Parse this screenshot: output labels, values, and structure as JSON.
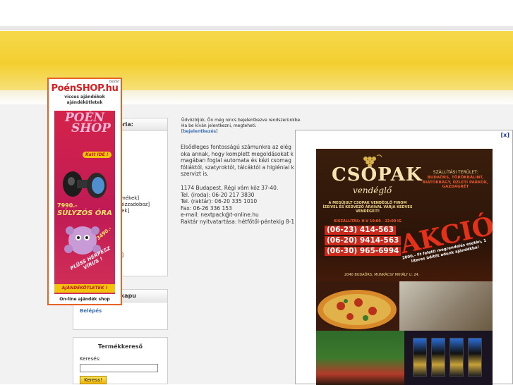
{
  "left": {
    "categories_title": "ória:",
    "categories": [
      "]",
      "",
      "r]",
      "",
      "",
      "k]",
      "k]",
      "",
      "",
      "ermékek]",
      "k pizzadoboz]",
      "ékek]",
      "",
      "",
      "",
      "",
      "",
      "",
      "ek]"
    ],
    "login_title": "kapu",
    "login_link": "Belépés",
    "search_title": "Termékkereső",
    "search_label": "Keresés:",
    "search_button": "Keress!"
  },
  "poenshop_ad": {
    "close": "bezár",
    "logo": "PoénSHOP.hu",
    "tagline_1": "vicces ajándékok",
    "tagline_2": "ajándékötletek",
    "brand_1": "POÉN",
    "brand_2": "SHOP",
    "katt": "Katt IDE !",
    "price_1": "7990.-",
    "product_1": "SÚLYZÓS ÓRA",
    "price_2": "3490.-",
    "product_2_line1": "PLÜSS HERPESZ",
    "product_2_line2": "VÍRUS !",
    "banner": "AJÁNDÉKÖTLETEK !",
    "footer": "On-line ajándék shop"
  },
  "main": {
    "welcome_1": "Üdvözöljük, Ön még nincs bejelentkezve rendszerünkbe.",
    "welcome_2": "Ha be kíván jelentkezni, megteheti.",
    "welcome_link": "bejelentkezés",
    "intro": [
      "Elsődleges fontosságú számunkra az elég",
      "oka annak, hogy komplett megoldásokat k",
      "magában foglal automata és kézi csomag",
      "fóliáktól, szatyroktól, tálcáktól a higiéniai k",
      "szervizt is."
    ],
    "contact": [
      "1174 Budapest, Régi vám köz 37-40.",
      "Tel. (iroda): 06-20 217 3830",
      "Tel. (raktár): 06-20 335 1010",
      "Fax: 06-26 336 153",
      "e-mail: nextpack@t-online.hu",
      "Raktár nyitvatartása: hétfőtől-péntekig 8-1"
    ]
  },
  "popup": {
    "close": "[x]",
    "logo": "CSOPAK",
    "logo_sub": "vendéglő",
    "delivery_title": "SZÁLLÍTÁSI TERÜLET:",
    "delivery_areas": "BUDAÖRS, TÖRÖKBÁLINT, BIATORBÁGY, ÜZLETI PARKOK, GAZDAGRÉT",
    "promo": "A MEGÚJULT CSOPAK VENDÉGLŐ FINOM ÍZEIVEL ÉS KEDVEZŐ ÁRAIVAL VÁRJA KEDVES VENDÉGEIT!",
    "hours": "KISZÁLLÍTÁS: H-V 10:00 - 22:00 IG",
    "phones": [
      "(06-23) 414-563",
      "(06-20) 9414-563",
      "(06-30) 965-6994"
    ],
    "address": "2040 BUDAÖRS, MUNKÁCSY MIHÁLY U. 24.",
    "akcio": "AKCIÓ!",
    "offer": "2000,- Ft feletti megrendelés esetén, 1 literes üdítőt adunk ajándékba!"
  },
  "colors": {
    "banner": "#f3cf30",
    "poen_border": "#e8632a",
    "poen_bg": "#c01a55",
    "link": "#3b6fb5",
    "csopak_red": "#c9281a"
  }
}
